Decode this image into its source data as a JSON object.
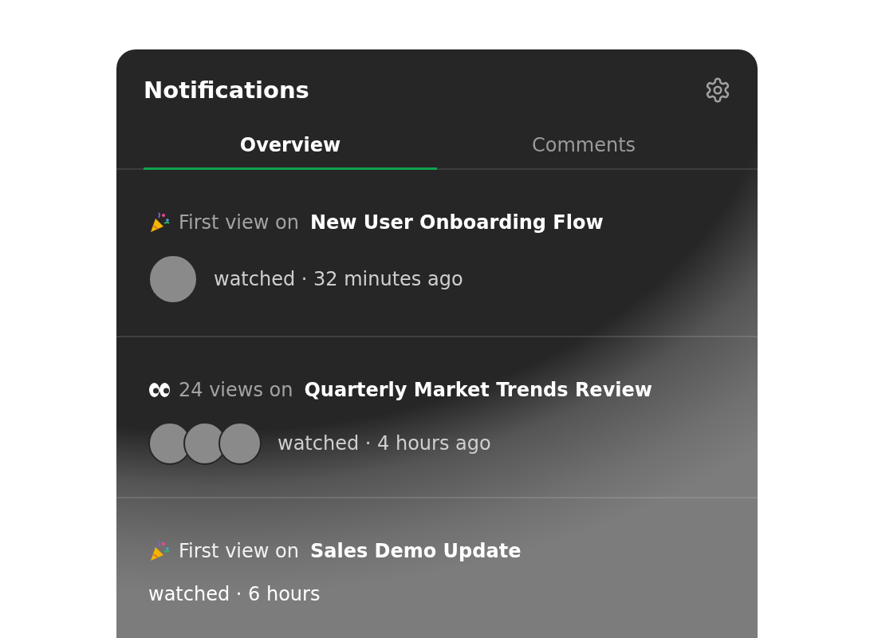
{
  "panel": {
    "title": "Notifications"
  },
  "tabs": [
    {
      "label": "Overview",
      "selected": true
    },
    {
      "label": "Comments",
      "selected": false
    }
  ],
  "notifications": [
    {
      "kind": "party",
      "action": "First view on",
      "subject": "New User Onboarding Flow",
      "meta": "watched · 32 minutes ago",
      "avatars": [
        {
          "kind": "photo"
        }
      ]
    },
    {
      "kind": "eyes",
      "action": "24 views on",
      "subject": "Quarterly Market Trends Review",
      "meta": "watched · 4 hours ago",
      "avatars": [
        {
          "kind": "photo"
        },
        {
          "kind": "photo"
        },
        {
          "kind": "photo"
        }
      ]
    },
    {
      "kind": "party",
      "action": "First view on",
      "subject": "Sales Demo Update",
      "meta": "watched · 6 hours"
    }
  ]
}
